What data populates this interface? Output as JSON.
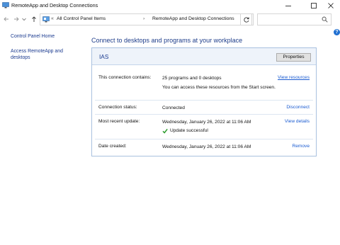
{
  "window": {
    "title": "RemoteApp and Desktop Connections"
  },
  "nav": {
    "breadcrumb_overflow": "«",
    "breadcrumb": [
      "All Control Panel Items",
      "RemoteApp and Desktop Connections"
    ],
    "breadcrumb_sep": "›",
    "search_placeholder": ""
  },
  "sidebar": {
    "items": [
      {
        "label": "Control Panel Home"
      },
      {
        "label": "Access RemoteApp and desktops"
      }
    ]
  },
  "main": {
    "heading": "Connect to desktops and programs at your workplace",
    "connection": {
      "name": "IAS",
      "properties_label": "Properties",
      "rows": {
        "contains": {
          "label": "This connection contains:",
          "value": "25 programs and 0 desktops",
          "note": "You can access these resources from the Start screen.",
          "action": "View resources"
        },
        "status": {
          "label": "Connection status:",
          "value": "Connected",
          "action": "Disconnect"
        },
        "update": {
          "label": "Most recent update:",
          "value": "Wednesday, January 26, 2022 at 11:06 AM",
          "result": "Update successful",
          "action": "View details"
        },
        "created": {
          "label": "Date created:",
          "value": "Wednesday, January 26, 2022 at 11:06 AM",
          "action": "Remove"
        }
      }
    }
  },
  "colors": {
    "link": "#1a5bd1",
    "heading": "#1e3d8a",
    "card_border": "#a9c1df",
    "card_header_bg": "#eef3fa",
    "success": "#2e9c2e"
  }
}
